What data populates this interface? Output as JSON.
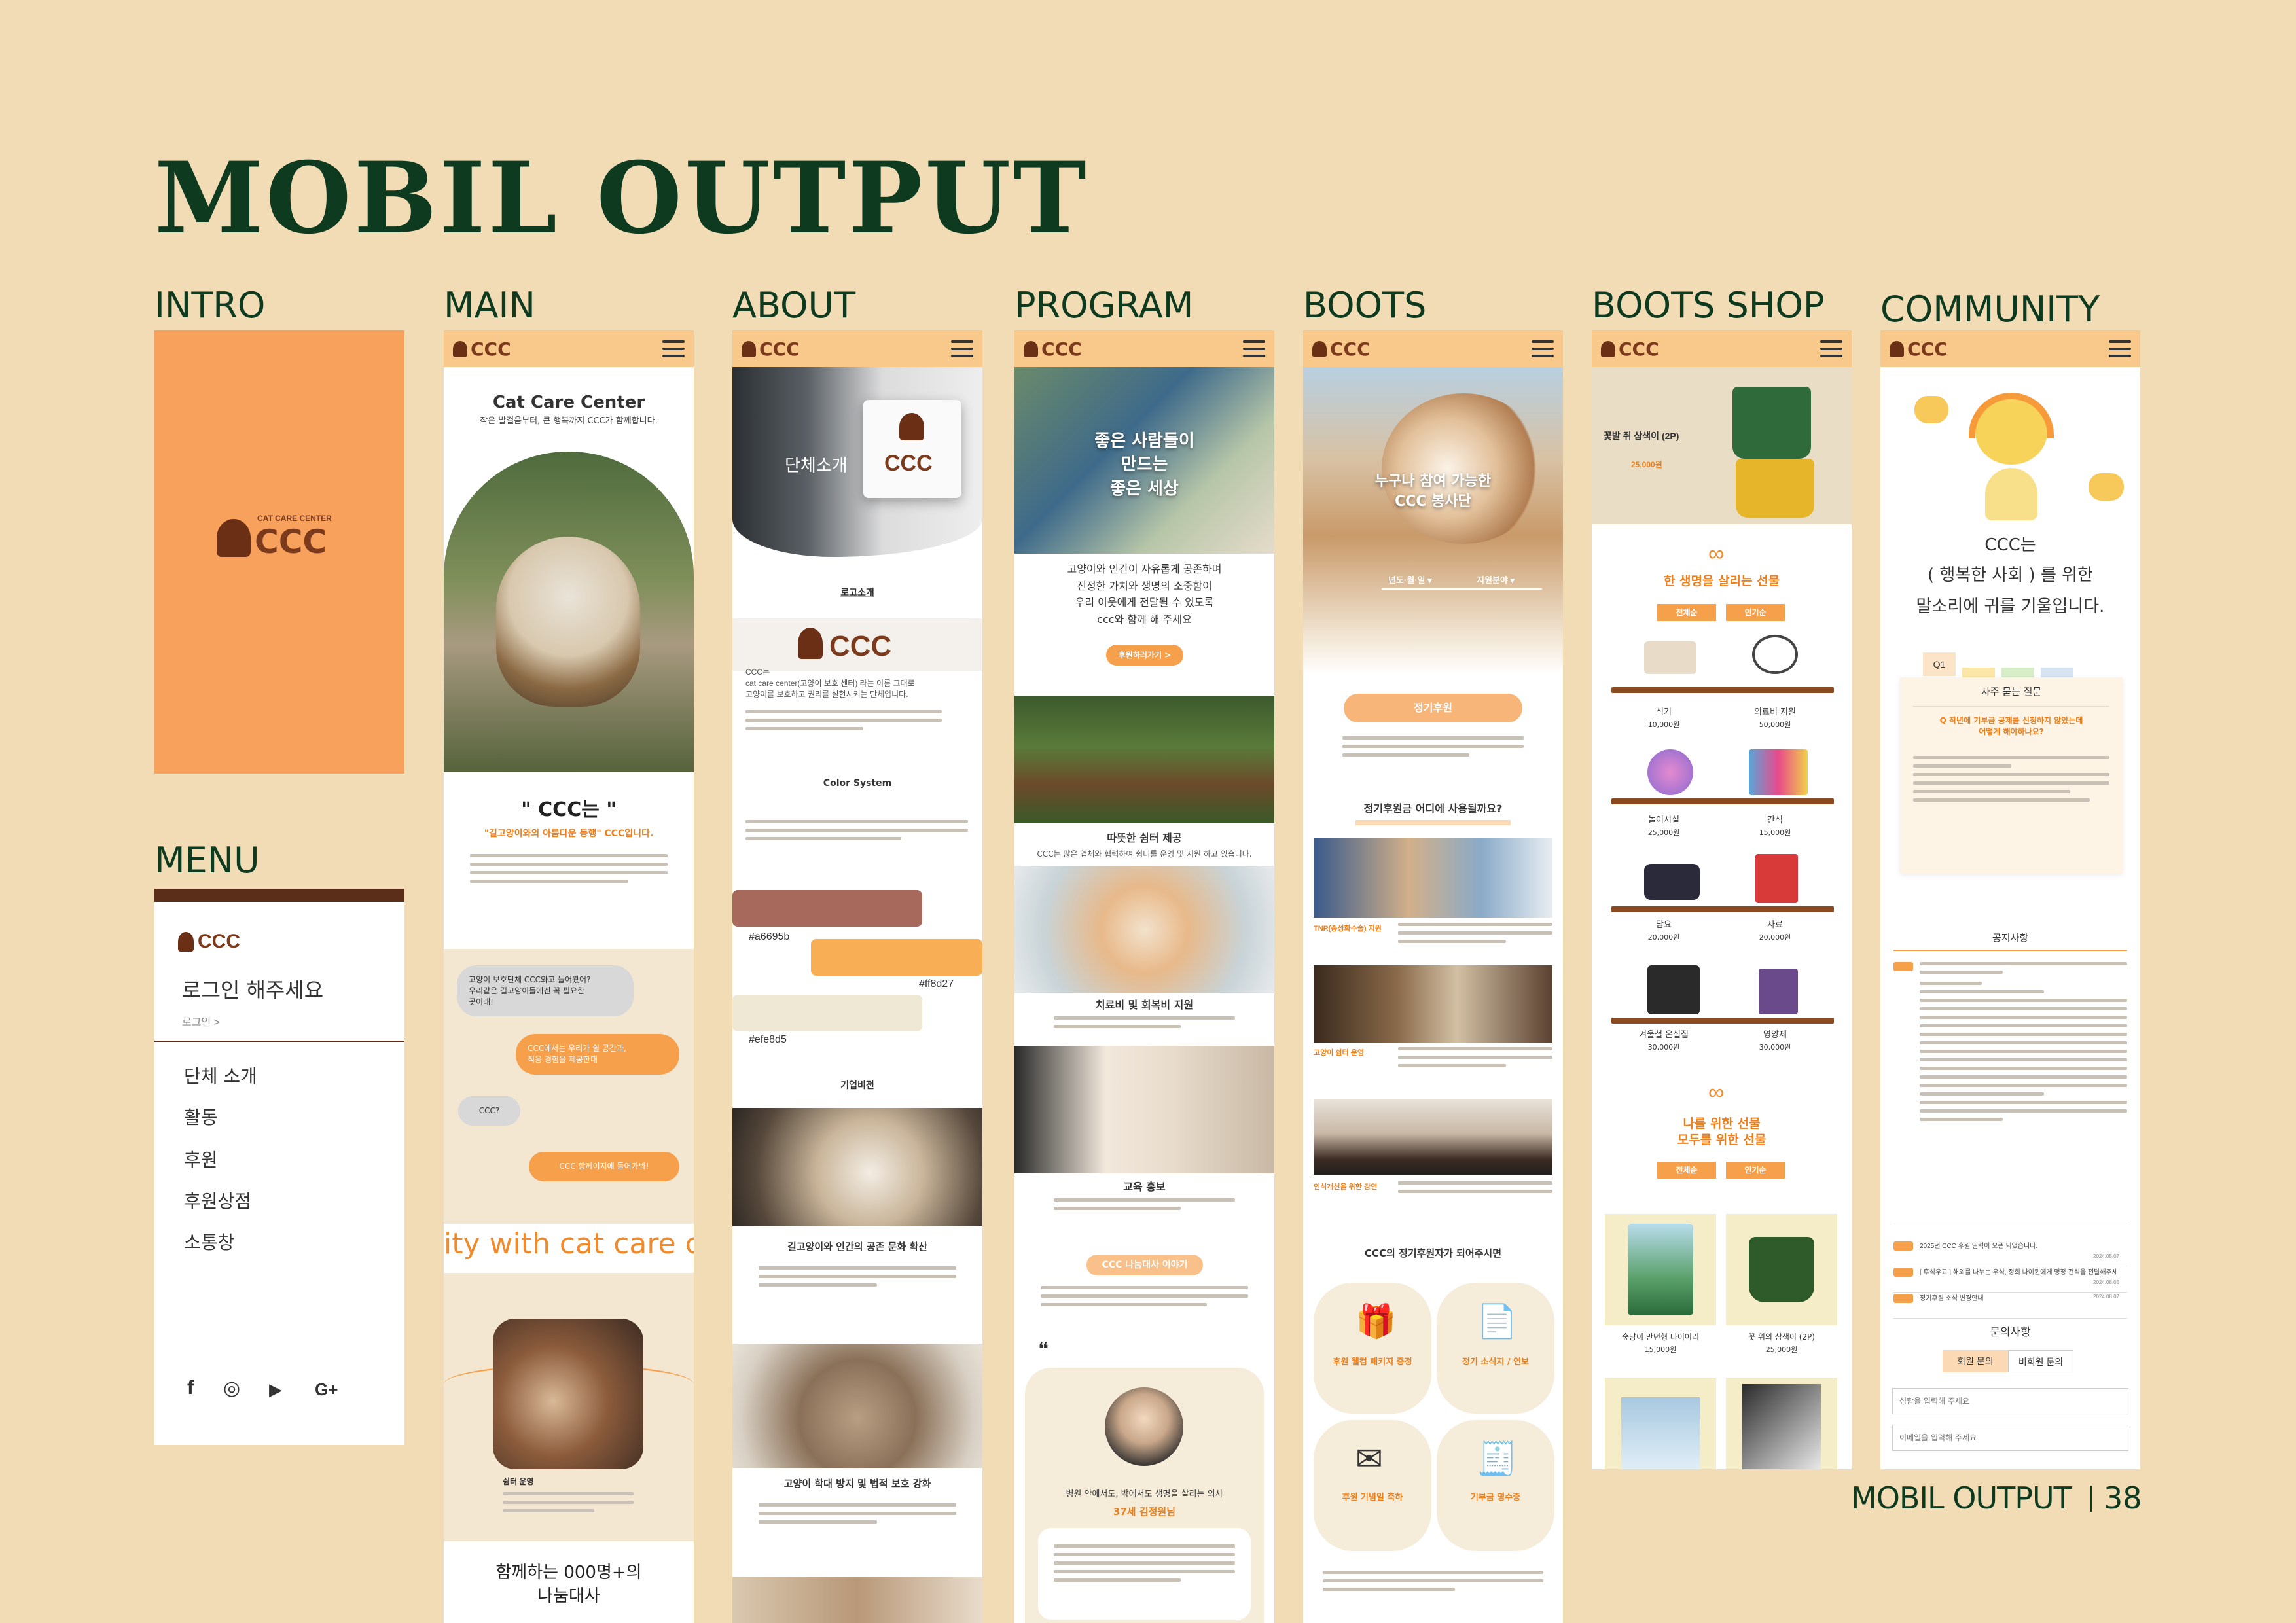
{
  "page": {
    "title": "MOBIL OUTPUT",
    "footer_title": "MOBIL OUTPUT",
    "page_number": "38"
  },
  "labels": {
    "intro": "INTRO",
    "main": "MAIN",
    "about": "ABOUT",
    "program": "PROGRAM",
    "boots": "BOOTS",
    "boots_shop": "BOOTS SHOP",
    "community": "COMMUNITY",
    "menu": "MENU"
  },
  "brand": {
    "short": "CCC",
    "full": "CAT CARE CENTER"
  },
  "menu_screen": {
    "login_title": "로그인 해주세요",
    "login_link": "로그인 >",
    "items": [
      "단체 소개",
      "활동",
      "후원",
      "후원상점",
      "소통창"
    ],
    "social": [
      "f",
      "◎",
      "▶",
      "G+"
    ]
  },
  "main_screen": {
    "title": "Cat Care Center",
    "subtitle": "작은 발걸음부터, 큰 행복까지 CCC가 함께합니다.",
    "section_title": "\" CCC는 \"",
    "section_sub": "\"길고양이와의 아름다운 동행\" CCC입니다.",
    "bubbles": [
      "고양이 보호단체 CCC와고 들어봤어?\n우리같은 길고양이들에겐 꼭 필요한\n곳이래!",
      "CCC에서는 우리가 쉴 공간과,\n적응 경험을 제공한대",
      "CCC?",
      "CCC 함께이지에 들어가봐!"
    ],
    "marquee": "ity with cat care ce",
    "card_title": "쉼터 운영",
    "ambassador": "함께하는 000명+의\n나눔대사"
  },
  "about_screen": {
    "hero": "단체소개",
    "section1": "로고소개",
    "intro": "CCC는\ncat care center(고양이 보호 센터) 라는 이름 그대로\n고양이를 보호하고 권리를 실현시키는 단체입니다.",
    "section2": "Color System",
    "colors": [
      {
        "hex": "#a6695b",
        "label": "#a6695b"
      },
      {
        "hex": "#f8ae55",
        "label": "#ff8d27"
      },
      {
        "hex": "#efe8d5",
        "label": "#efe8d5"
      }
    ],
    "section3": "기업비전",
    "vision1": "길고양이와 인간의 공존 문화 확산",
    "vision2": "고양이 학대 방지 및 법적 보호 강화"
  },
  "program_screen": {
    "hero": "좋은 사람들이\n만드는\n좋은 세상",
    "intro": "고양이와 인간이 자유롭게 공존하며\n진정한 가치와 생명의 소중함이\n우리 이웃에게 전달될 수 있도록\nccc와 함께 해 주세요",
    "cta": "후원하러가기 >",
    "p1": "따뜻한 쉼터 제공",
    "p1_desc": "CCC는 많은 업체와 협력하여 쉼터를 운영 및 지원 하고 있습니다.",
    "p2": "치료비 및 회복비 지원",
    "p3": "교육 홍보",
    "story_btn": "CCC 나눔대사 이야기",
    "story_name": "병원 안에서도, 밖에서도 생명을 살리는 의사",
    "story_sub": "37세 김정원님"
  },
  "boots_screen": {
    "hero": "누구나 참여 가능한\nCCC 봉사단",
    "filters": [
      "년도·월·일 ▾",
      "지원분야 ▾"
    ],
    "regular": "정기후원",
    "question": "정기후원금 어디에 사용될까요?",
    "uses": [
      "TNR(중성화수술) 지원",
      "고양이 쉼터 운영",
      "인식개선을 위한 강연"
    ],
    "benefit_title": "CCC의 정기후원자가 되어주시면",
    "benefits": [
      "후원 웰컴 패키지 증정",
      "정기 소식지 / 연보",
      "후원 기념일 축하",
      "기부금 영수증"
    ]
  },
  "shop_screen": {
    "hero_title": "꽃발 쥐 삼색이 (2P)",
    "hero_price": "25,000원",
    "section1": "한 생명을 살리는 선물",
    "section2": "나를 위한 선물\n모두를 위한 선물",
    "tabs": [
      "전체순",
      "인기순"
    ],
    "items": [
      {
        "name": "식기",
        "price": "10,000원"
      },
      {
        "name": "의료비 지원",
        "price": "50,000원"
      },
      {
        "name": "놀이시설",
        "price": "25,000원"
      },
      {
        "name": "간식",
        "price": "15,000원"
      },
      {
        "name": "담요",
        "price": "20,000원"
      },
      {
        "name": "사료",
        "price": "20,000원"
      },
      {
        "name": "겨울철 온실집",
        "price": "30,000원"
      },
      {
        "name": "영양제",
        "price": "30,000원"
      }
    ],
    "goods": [
      {
        "name": "숲냥이 만년형 다이어리",
        "price": "15,000원"
      },
      {
        "name": "꽃 위의 삼색이 (2P)",
        "price": "25,000원"
      }
    ]
  },
  "community_screen": {
    "headline_1": "CCC는",
    "headline_2": "( 행복한 사회 ) 를 위한",
    "headline_3": "말소리에 귀를 기울입니다.",
    "faq_tab": "Q1",
    "faq_title": "자주 묻는 질문",
    "faq_q": "Q 작년에 기부금 공제를 신청하지 않았는데\n어떻게 해야하나요?",
    "notice_title": "공지사항",
    "notices": [
      {
        "title": "2025년 CCC 후원 일력이 오픈 되었습니다.",
        "date": "2024.05.07"
      },
      {
        "title": "[ 후식우교 ] 해외를 나누는 우식, 정회 나이퀸에게 명정 건식을 전달해주세요",
        "date": "2024.08.05"
      },
      {
        "title": "정기후원 소식 변경안내",
        "date": "2024.08.07"
      }
    ],
    "inquiry_title": "문의사항",
    "inquiry_tabs": [
      "회원 문의",
      "비회원 문의"
    ],
    "name_placeholder": "성함을 입력해 주세요",
    "email_placeholder": "이메일을 입력해 주세요"
  }
}
